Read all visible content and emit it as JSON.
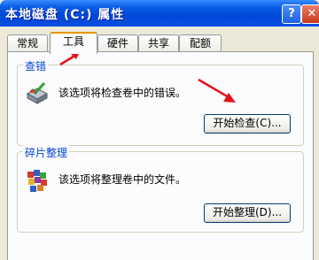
{
  "window": {
    "title": "本地磁盘 (C:) 属性",
    "help_label": "?",
    "close_label": "✕"
  },
  "tabs": [
    {
      "label": "常规"
    },
    {
      "label": "工具"
    },
    {
      "label": "硬件"
    },
    {
      "label": "共享"
    },
    {
      "label": "配额"
    }
  ],
  "error_check": {
    "group_label": "查错",
    "description": "该选项将检查卷中的错误。",
    "button_label": "开始检查(C)..."
  },
  "defrag": {
    "group_label": "碎片整理",
    "description": "该选项将整理卷中的文件。",
    "button_label": "开始整理(D)..."
  },
  "colors": {
    "titlebar": "#0047d8",
    "group_label": "#0046d5",
    "annotation_arrow": "#e8101a"
  },
  "icons": [
    "help-icon",
    "close-icon",
    "disk-check-icon",
    "defrag-icon"
  ]
}
